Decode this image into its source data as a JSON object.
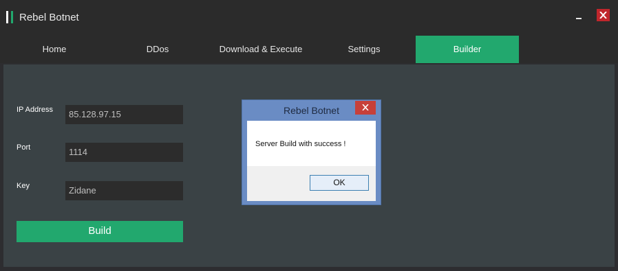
{
  "window": {
    "title": "Rebel Botnet",
    "minimize_glyph": "–",
    "close_icon": "close-icon"
  },
  "tabs": [
    {
      "label": "Home",
      "active": false
    },
    {
      "label": "DDos",
      "active": false
    },
    {
      "label": "Download & Execute",
      "active": false
    },
    {
      "label": "Settings",
      "active": false
    },
    {
      "label": "Builder",
      "active": true
    }
  ],
  "builder": {
    "ip": {
      "label": "IP Address",
      "value": "85.128.97.15"
    },
    "port": {
      "label": "Port",
      "value": "1114"
    },
    "key": {
      "label": "Key",
      "value": "Zidane"
    },
    "build_label": "Build"
  },
  "dialog": {
    "title": "Rebel Botnet",
    "message": "Server Build with success !",
    "ok_label": "OK"
  },
  "colors": {
    "accent": "#22a86e",
    "titlebar": "#2b2b2b",
    "panel": "#3a4245",
    "close_red": "#c0262c"
  }
}
